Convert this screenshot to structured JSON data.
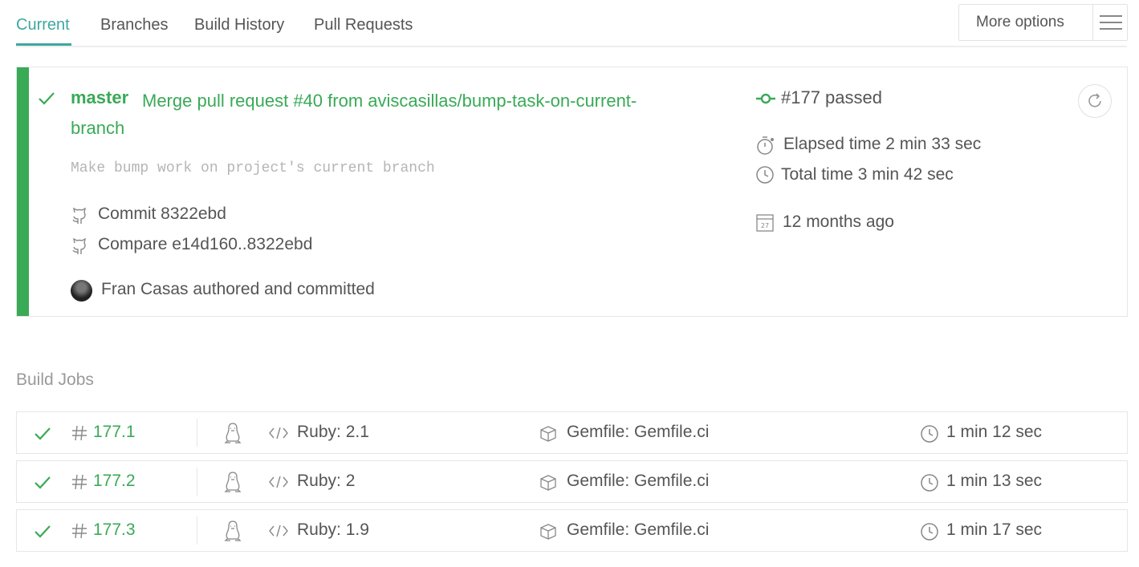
{
  "tabs": [
    {
      "label": "Current",
      "active": true
    },
    {
      "label": "Branches"
    },
    {
      "label": "Build History"
    },
    {
      "label": "Pull Requests"
    }
  ],
  "more_options": {
    "label": "More options",
    "icon": "hamburger-menu-icon"
  },
  "build": {
    "status_color": "#39aa56",
    "branch": "master",
    "commit_message": "Merge pull request #40 from aviscasillas/bump-task-on-current-branch",
    "description": "Make bump work on project's current branch",
    "commit_label": "Commit 8322ebd",
    "compare_label": "Compare e14d160..8322ebd",
    "author_label": "Fran Casas authored and committed",
    "number_status": "#177 passed",
    "elapsed_time": "Elapsed time 2 min 33 sec",
    "total_time": "Total time 3 min 42 sec",
    "finished": "12 months ago"
  },
  "build_jobs": {
    "title": "Build Jobs",
    "jobs": [
      {
        "number": "177.1",
        "language": "Ruby: 2.1",
        "gemfile": "Gemfile: Gemfile.ci",
        "duration": "1 min 12 sec"
      },
      {
        "number": "177.2",
        "language": "Ruby: 2",
        "gemfile": "Gemfile: Gemfile.ci",
        "duration": "1 min 13 sec"
      },
      {
        "number": "177.3",
        "language": "Ruby: 1.9",
        "gemfile": "Gemfile: Gemfile.ci",
        "duration": "1 min 17 sec"
      }
    ]
  }
}
